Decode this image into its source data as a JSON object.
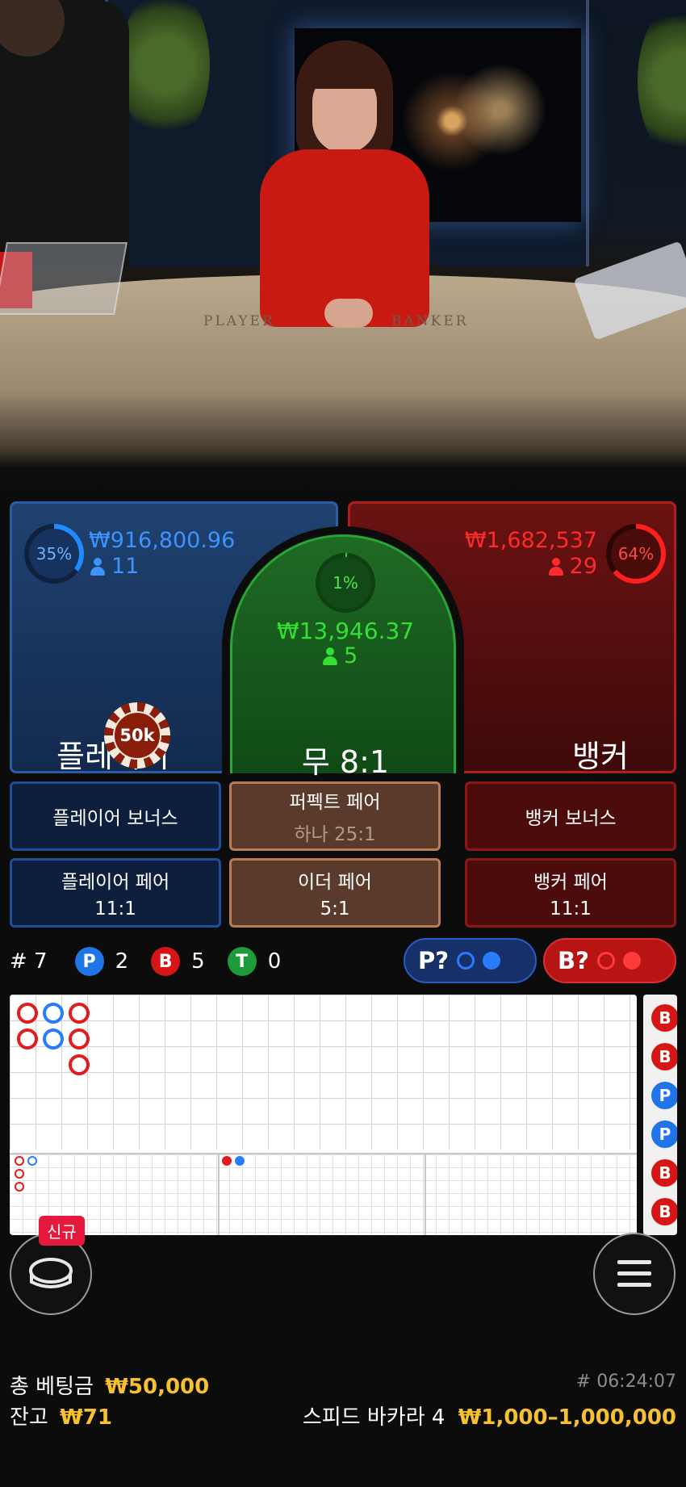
{
  "video": {
    "table_left_word": "PLAYER",
    "table_right_word": "BANKER"
  },
  "player": {
    "percent": "35%",
    "amount": "₩916,800.96",
    "bettors": "11",
    "label": "플레이어",
    "color": "#2e86ff"
  },
  "tie": {
    "percent": "1%",
    "amount": "₩13,946.37",
    "bettors": "5",
    "label": "무 8:1",
    "color": "#2fd22f"
  },
  "banker": {
    "percent": "64%",
    "amount": "₩1,682,537",
    "bettors": "29",
    "label": "뱅커",
    "color": "#ff1f1f"
  },
  "chip": {
    "value": "50k"
  },
  "side_bets": {
    "player_bonus": "플레이어 보너스",
    "perfect_pair": "퍼펙트 페어",
    "perfect_pair_sub": "하나 25:1",
    "banker_bonus": "뱅커 보너스",
    "player_pair": "플레이어 페어",
    "player_pair_odds": "11:1",
    "either_pair": "이더 페어",
    "either_pair_odds": "5:1",
    "banker_pair": "뱅커 페어",
    "banker_pair_odds": "11:1"
  },
  "stats": {
    "round": "# 7",
    "p_label": "P",
    "p_count": "2",
    "b_label": "B",
    "b_count": "5",
    "t_label": "T",
    "t_count": "0"
  },
  "ask": {
    "player_label": "P?",
    "banker_label": "B?"
  },
  "road": {
    "side_beads": [
      "B",
      "B",
      "P",
      "P",
      "B",
      "B"
    ]
  },
  "chat": {
    "badge": "신규"
  },
  "footer": {
    "total_bet_label": "총 베팅금",
    "total_bet_value": "₩50,000",
    "balance_label": "잔고",
    "balance_value": "₩71",
    "round_id": "# 06:24:07",
    "table_name": "스피드 바카라 4",
    "limits": "₩1,000–1,000,000"
  }
}
